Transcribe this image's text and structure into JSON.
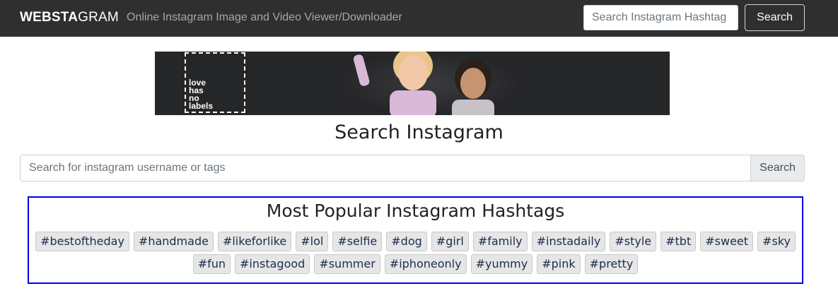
{
  "navbar": {
    "brand_bold": "WEBSTA",
    "brand_light": "GRAM",
    "tagline": "Online Instagram Image and Video Viewer/Downloader",
    "search_placeholder": "Search Instagram Hashtag",
    "search_button": "Search",
    "bg_color": "#2f2f2f"
  },
  "banner": {
    "logo_lines": [
      "love",
      "has",
      "no",
      "labels"
    ]
  },
  "main": {
    "title": "Search Instagram",
    "search_placeholder": "Search for instagram username or tags",
    "search_button": "Search"
  },
  "hashtags": {
    "title": "Most Popular Instagram Hashtags",
    "border_color": "#0000e6",
    "items": [
      "#bestoftheday",
      "#handmade",
      "#likeforlike",
      "#lol",
      "#selfie",
      "#dog",
      "#girl",
      "#family",
      "#instadaily",
      "#style",
      "#tbt",
      "#sweet",
      "#sky",
      "#fun",
      "#instagood",
      "#summer",
      "#iphoneonly",
      "#yummy",
      "#pink",
      "#pretty"
    ]
  }
}
